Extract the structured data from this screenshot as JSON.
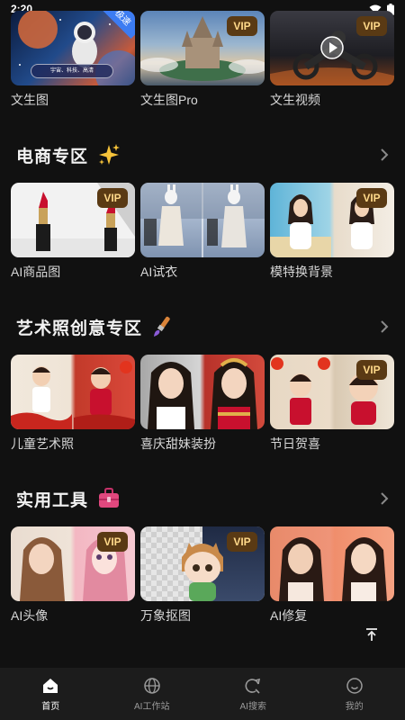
{
  "status_bar": {
    "time": "2:20"
  },
  "top_row": [
    {
      "label": "文生图",
      "badge": "极速",
      "tagline": "宇宙、科技、高清"
    },
    {
      "label": "文生图Pro",
      "badge": "VIP"
    },
    {
      "label": "文生视频",
      "badge": "VIP"
    }
  ],
  "sections": [
    {
      "title": "电商专区",
      "icon": "sparkles-icon",
      "items": [
        {
          "label": "AI商品图",
          "badge": "VIP"
        },
        {
          "label": "AI试衣",
          "badge": ""
        },
        {
          "label": "模特换背景",
          "badge": "VIP"
        }
      ]
    },
    {
      "title": "艺术照创意专区",
      "icon": "paintbrush-icon",
      "items": [
        {
          "label": "儿童艺术照",
          "badge": ""
        },
        {
          "label": "喜庆甜妹装扮",
          "badge": ""
        },
        {
          "label": "节日贺喜",
          "badge": "VIP"
        }
      ]
    },
    {
      "title": "实用工具",
      "icon": "toolbox-icon",
      "items": [
        {
          "label": "AI头像",
          "badge": "VIP"
        },
        {
          "label": "万象抠图",
          "badge": "VIP"
        },
        {
          "label": "AI修复",
          "badge": ""
        }
      ]
    }
  ],
  "tab_bar": {
    "active_index": 0,
    "tabs": [
      {
        "label": "首页",
        "icon": "home-icon"
      },
      {
        "label": "AI工作站",
        "icon": "globe-icon"
      },
      {
        "label": "AI搜索",
        "icon": "search-refresh-icon"
      },
      {
        "label": "我的",
        "icon": "smiley-face-icon"
      }
    ]
  },
  "colors": {
    "background": "#111111",
    "tab_bar": "#1c1c1c",
    "vip_badge_bg": "#5a3a14",
    "vip_badge_text": "#ffd98a",
    "fast_badge": "#3c7cf2"
  }
}
